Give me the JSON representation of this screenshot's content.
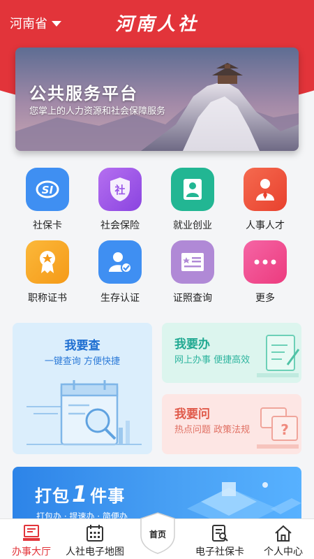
{
  "header": {
    "province": "河南省",
    "title": "河南人社"
  },
  "banner": {
    "title": "公共服务平台",
    "subtitle": "您掌上的人力资源和社会保障服务"
  },
  "services": [
    {
      "label": "社保卡",
      "icon": "social-security-card-icon",
      "color": "#3f8ff2"
    },
    {
      "label": "社会保险",
      "icon": "shield-icon",
      "color": "#9b57e8"
    },
    {
      "label": "就业创业",
      "icon": "employee-badge-icon",
      "color": "#22b693"
    },
    {
      "label": "人事人才",
      "icon": "person-tie-icon",
      "color": "#f0533b"
    },
    {
      "label": "职称证书",
      "icon": "medal-icon",
      "color": "#f5a623"
    },
    {
      "label": "生存认证",
      "icon": "user-check-icon",
      "color": "#3f8ff2"
    },
    {
      "label": "证照查询",
      "icon": "certificate-icon",
      "color": "#b089d6"
    },
    {
      "label": "更多",
      "icon": "more-icon",
      "color": "#f0478d"
    }
  ],
  "cards": {
    "query": {
      "title": "我要查",
      "subtitle": "一键查询  方便快捷"
    },
    "handle": {
      "title": "我要办",
      "subtitle": "网上办事  便捷高效"
    },
    "ask": {
      "title": "我要问",
      "subtitle": "热点问题  政策法规"
    }
  },
  "promo": {
    "prefix": "打包",
    "number": "1",
    "suffix": "件事",
    "subtitle": "打包办 · 提速办 · 简便办"
  },
  "tabbar": {
    "home_label": "首页",
    "items": [
      {
        "label": "办事大厅",
        "icon": "service-hall-icon",
        "active": true
      },
      {
        "label": "人社电子地图",
        "icon": "calendar-map-icon",
        "active": false
      },
      {
        "label": "电子社保卡",
        "icon": "e-card-search-icon",
        "active": false
      },
      {
        "label": "个人中心",
        "icon": "home-icon",
        "active": false
      }
    ]
  },
  "colors": {
    "brand_red": "#e2343a",
    "query_blue": "#1f6fd1",
    "handle_teal": "#21a992",
    "ask_red": "#e05a4a"
  }
}
